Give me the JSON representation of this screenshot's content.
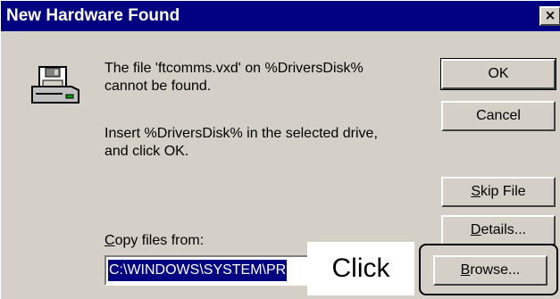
{
  "window": {
    "title": "New Hardware Found",
    "close_glyph": "×"
  },
  "message": {
    "line1": "The file 'ftcomms.vxd' on %DriversDisk%",
    "line2": "cannot be found.",
    "line3": "Insert %DriversDisk% in the selected drive,",
    "line4": "and click OK."
  },
  "buttons": {
    "ok": "OK",
    "cancel": "Cancel",
    "skip_file_mnemonic": "S",
    "skip_file_rest": "kip File",
    "details_mnemonic": "D",
    "details_rest": "etails...",
    "browse_mnemonic": "B",
    "browse_rest": "rowse..."
  },
  "copy_from": {
    "label_mnemonic": "C",
    "label_rest": "opy files from:",
    "value": "C:\\WINDOWS\\SYSTEM\\PR"
  },
  "annotation": {
    "callout": "Click"
  },
  "icons": {
    "drive": "floppy-drive-icon",
    "close": "close-icon"
  }
}
